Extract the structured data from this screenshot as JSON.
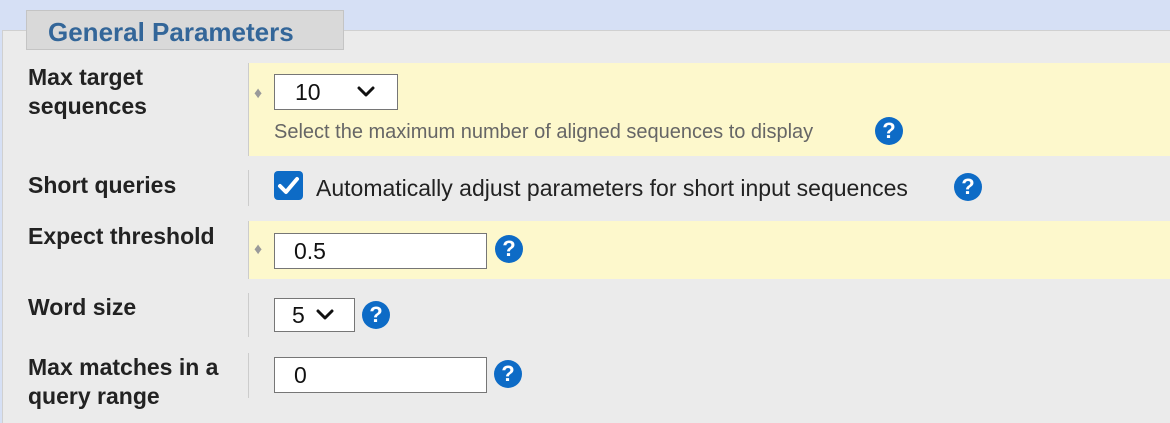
{
  "section": {
    "title": "General Parameters"
  },
  "max_target_sequences": {
    "label_line1": "Max target",
    "label_line2": "sequences",
    "selected_value": "10",
    "hint": "Select the maximum number of aligned sequences to display",
    "help_glyph": "?"
  },
  "short_queries": {
    "label": "Short queries",
    "checked": true,
    "checkbox_label": "Automatically adjust parameters for short input sequences",
    "help_glyph": "?"
  },
  "expect_threshold": {
    "label": "Expect threshold",
    "value": "0.5",
    "help_glyph": "?"
  },
  "word_size": {
    "label": "Word size",
    "selected_value": "5",
    "help_glyph": "?"
  },
  "max_matches": {
    "label_line1": "Max matches in a",
    "label_line2": "query range",
    "value": "0",
    "help_glyph": "?"
  },
  "colors": {
    "header_text": "#336699",
    "help_icon": "#0d6bc6",
    "highlight_row": "#fdf8cc",
    "panel_bg": "#ebebeb",
    "page_bg": "#d6e0f5"
  },
  "icons": {
    "dropdown": "chevron-down-icon",
    "help": "help-icon",
    "required": "diamond-icon",
    "checkbox": "checkmark-icon"
  }
}
